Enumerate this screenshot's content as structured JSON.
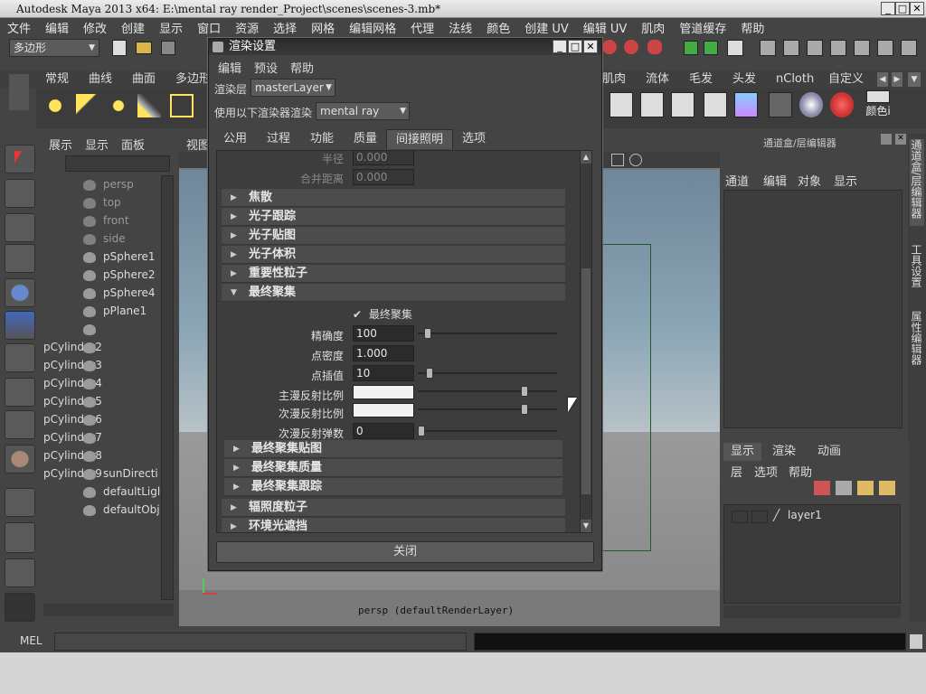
{
  "window": {
    "title": "Autodesk Maya 2013 x64: E:\\mental ray render_Project\\scenes\\scenes-3.mb*"
  },
  "menubar": [
    "文件",
    "编辑",
    "修改",
    "创建",
    "显示",
    "窗口",
    "资源",
    "选择",
    "网格",
    "编辑网格",
    "代理",
    "法线",
    "颜色",
    "创建 UV",
    "编辑 UV",
    "肌肉",
    "管道缓存",
    "帮助"
  ],
  "toolbar": {
    "mode_select": "多边形"
  },
  "shelf_tabs": [
    "常规",
    "曲线",
    "曲面",
    "多边形",
    "肌肉",
    "流体",
    "毛发",
    "头发",
    "nCloth",
    "自定义"
  ],
  "shelf_label": "颜色i",
  "outliner": {
    "menu": [
      "展示",
      "显示",
      "面板"
    ],
    "items": [
      "persp",
      "top",
      "front",
      "side",
      "pSphere1",
      "pSphere2",
      "pSphere4",
      "pPlane1",
      "pCylinder2",
      "pCylinder3",
      "pCylinder4",
      "pCylinder5",
      "pCylinder6",
      "pCylinder7",
      "pCylinder8",
      "pCylinder9",
      "sunDirecti",
      "defaultLigl",
      "defaultObj"
    ]
  },
  "viewport": {
    "menu": "视图",
    "camera_label": "persp (defaultRenderLayer)"
  },
  "channel_box": {
    "title": "通道盒/层编辑器",
    "menu": [
      "通道",
      "编辑",
      "对象",
      "显示"
    ]
  },
  "side_tabs": [
    "通道盒/层编辑器",
    "工具设置",
    "属性编辑器"
  ],
  "layer_editor": {
    "tabs": [
      "显示",
      "渲染",
      "动画"
    ],
    "menu": [
      "层",
      "选项",
      "帮助"
    ],
    "layer_name": "layer1"
  },
  "dialog": {
    "title": "渲染设置",
    "menu": [
      "编辑",
      "预设",
      "帮助"
    ],
    "render_layer_label": "渲染层",
    "render_layer_value": "masterLayer",
    "renderer_label": "使用以下渲染器渲染",
    "renderer_value": "mental ray",
    "tabs": [
      "公用",
      "过程",
      "功能",
      "质量",
      "间接照明",
      "选项"
    ],
    "active_tab": "间接照明",
    "top_rows": [
      {
        "label": "半径",
        "value": "0.000"
      },
      {
        "label": "合并距离",
        "value": "0.000"
      }
    ],
    "sections": [
      "焦散",
      "光子跟踪",
      "光子贴图",
      "光子体积",
      "重要性粒子",
      "最终聚集"
    ],
    "final_gather": {
      "checkbox_label": "最终聚集",
      "checked": true,
      "accuracy_label": "精确度",
      "accuracy": "100",
      "accuracy_slider": 0.05,
      "point_density_label": "点密度",
      "point_density": "1.000",
      "point_interp_label": "点插值",
      "point_interp": "10",
      "point_interp_slider": 0.06,
      "primary_diffuse_label": "主漫反射比例",
      "primary_diffuse_slider": 0.78,
      "secondary_diffuse_label": "次漫反射比例",
      "secondary_diffuse_slider": 0.78,
      "secondary_bounces_label": "次漫反射弹数",
      "secondary_bounces": "0",
      "secondary_bounces_slider": 0.0
    },
    "sub_sections": [
      "最终聚集贴图",
      "最终聚集质量",
      "最终聚集跟踪"
    ],
    "more_sections": [
      "辐照度粒子",
      "环境光遮挡"
    ],
    "close_button": "关闭"
  },
  "statusbar": {
    "mel_label": "MEL"
  }
}
